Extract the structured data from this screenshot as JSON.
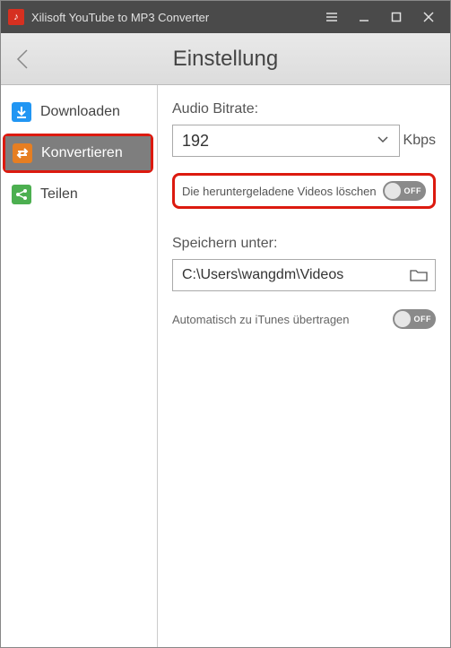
{
  "titlebar": {
    "app_title": "Xilisoft YouTube to MP3 Converter"
  },
  "header": {
    "page_title": "Einstellung"
  },
  "sidebar": {
    "items": [
      {
        "label": "Downloaden",
        "active": false
      },
      {
        "label": "Konvertieren",
        "active": true
      },
      {
        "label": "Teilen",
        "active": false
      }
    ]
  },
  "content": {
    "bitrate_label": "Audio Bitrate:",
    "bitrate_value": "192",
    "bitrate_unit": "Kbps",
    "delete_downloaded_label": "Die heruntergeladene Videos löschen",
    "delete_downloaded_state": "OFF",
    "save_under_label": "Speichern unter:",
    "save_under_path": "C:\\Users\\wangdm\\Videos",
    "auto_itunes_label": "Automatisch zu iTunes übertragen",
    "auto_itunes_state": "OFF"
  }
}
